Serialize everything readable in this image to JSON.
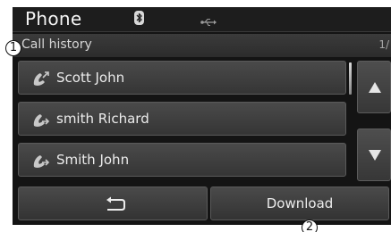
{
  "header": {
    "title": "Phone",
    "bluetooth_icon": "bluetooth-icon",
    "usb_icon": "usb-icon"
  },
  "subheader": {
    "label": "Call history",
    "page": "1/"
  },
  "call_history": [
    {
      "name": "Scott John",
      "icon": "outgoing-call-icon"
    },
    {
      "name": "smith Richard",
      "icon": "outgoing-call-icon"
    },
    {
      "name": "Smith John",
      "icon": "outgoing-call-icon"
    }
  ],
  "scroll": {
    "up_icon": "arrow-up-icon",
    "down_icon": "arrow-down-icon"
  },
  "bottom": {
    "back_icon": "back-icon",
    "download_label": "Download"
  },
  "callouts": {
    "one": "1",
    "two": "2"
  },
  "colors": {
    "screen_bg": "#141414",
    "button_top": "#4a4a4a",
    "button_bottom": "#353535",
    "text": "#ececec"
  }
}
